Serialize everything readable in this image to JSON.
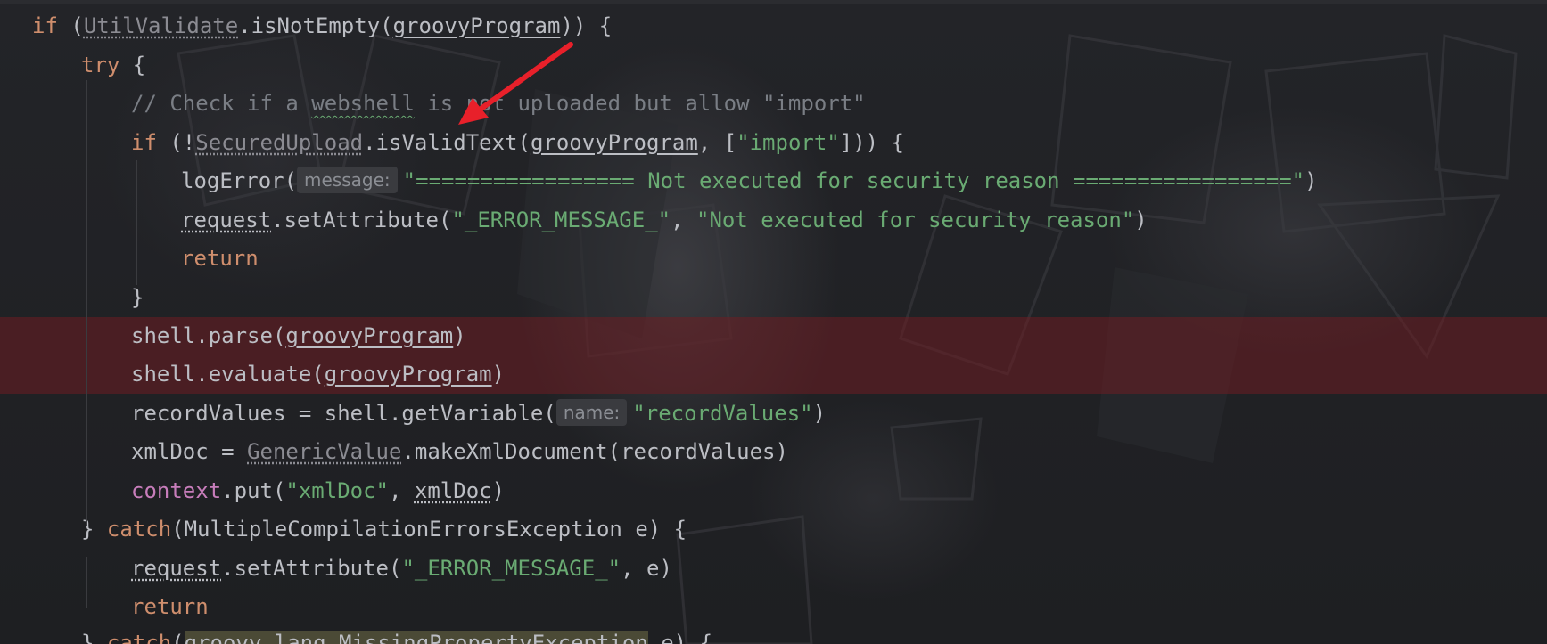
{
  "editor": {
    "lines": [
      {
        "parts": [
          "if",
          " (",
          "UtilValidate",
          ".isNotEmpty(",
          "groovyProgram",
          ")) {"
        ]
      },
      {
        "parts": [
          "try",
          " {"
        ]
      },
      {
        "parts": [
          "// Check if a ",
          "webshell",
          " is not uploaded but allow \"import\""
        ]
      },
      {
        "parts": [
          "if",
          " (!",
          "SecuredUpload",
          ".isValidText(",
          "groovyProgram",
          ", [",
          "\"import\"",
          "])) {"
        ]
      },
      {
        "parts": [
          "logError(",
          "message:",
          "\"================= Not executed for security reason =================\"",
          ")"
        ]
      },
      {
        "parts": [
          "request",
          ".setAttribute(",
          "\"_ERROR_MESSAGE_\"",
          ", ",
          "\"Not executed for security reason\"",
          ")"
        ]
      },
      {
        "parts": [
          "return"
        ]
      },
      {
        "parts": [
          "}"
        ]
      },
      {
        "parts": [
          "shell.parse(",
          "groovyProgram",
          ")"
        ]
      },
      {
        "parts": [
          "shell.evaluate(",
          "groovyProgram",
          ")"
        ]
      },
      {
        "parts": [
          "recordValues = shell.getVariable(",
          "name:",
          "\"recordValues\"",
          ")"
        ]
      },
      {
        "parts": [
          "xmlDoc = ",
          "GenericValue",
          ".makeXmlDocument(recordValues)"
        ]
      },
      {
        "parts": [
          "context",
          ".put(",
          "\"xmlDoc\"",
          ", ",
          "xmlDoc",
          ")"
        ]
      },
      {
        "parts": [
          "} ",
          "catch",
          "(MultipleCompilationErrorsException e) {"
        ]
      },
      {
        "parts": [
          "request",
          ".setAttribute(",
          "\"_ERROR_MESSAGE_\"",
          ", e)"
        ]
      },
      {
        "parts": [
          "return"
        ]
      },
      {
        "parts": [
          "} ",
          "catch",
          "(",
          "groovy.lang.MissingPropertyException",
          " e) {"
        ]
      }
    ]
  },
  "colors": {
    "background": "#1f2023",
    "keyword": "#cf8e6d",
    "string": "#6aab73",
    "text": "#bcbec4",
    "comment": "#7a7e85",
    "context": "#c77dbb",
    "highlight": "#6e1e22",
    "arrow": "#e8202a"
  },
  "annotations": {
    "arrow_icon": "red-arrow-icon"
  }
}
